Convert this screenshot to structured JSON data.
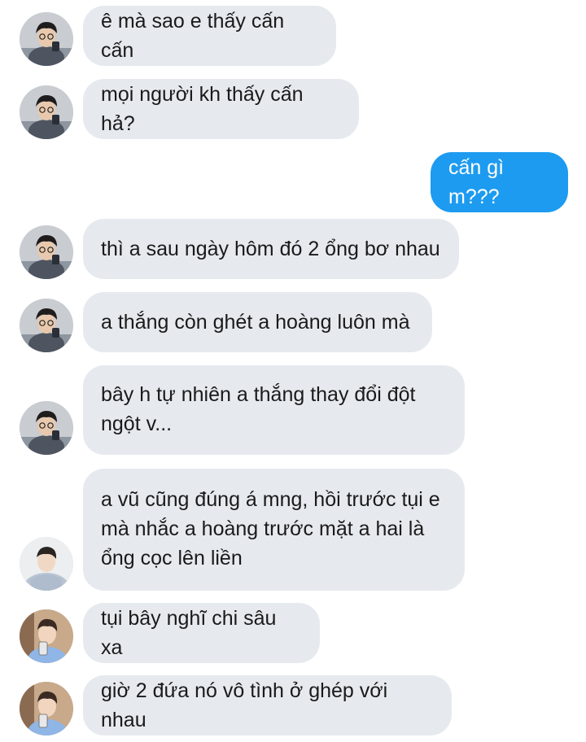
{
  "colors": {
    "incoming_bubble": "#e6eaef",
    "outgoing_bubble": "#1d9bf0",
    "incoming_text": "#1a1a1a",
    "outgoing_text": "#ffffff",
    "background": "#ffffff"
  },
  "messages": [
    {
      "sender": "user-a",
      "text": "ê mà sao e thấy cấn cấn"
    },
    {
      "sender": "user-a",
      "text": "mọi người kh thấy cấn hả?"
    },
    {
      "sender": "me",
      "text": "cấn gì m???"
    },
    {
      "sender": "user-a",
      "text": "thì a sau ngày hôm đó 2 ổng bơ nhau"
    },
    {
      "sender": "user-a",
      "text": "a thắng còn ghét a hoàng luôn mà"
    },
    {
      "sender": "user-a",
      "text": "bây h tự nhiên a thắng thay đổi đột\nngột v..."
    },
    {
      "sender": "user-b",
      "text": "a vũ cũng đúng á mng, hồi trước tụi e\nmà nhắc a hoàng trước mặt a hai là\nổng cọc lên liền"
    },
    {
      "sender": "user-c",
      "text": "tụi bây nghĩ chi sâu xa"
    },
    {
      "sender": "user-c",
      "text": "giờ 2 đứa nó vô tình ở ghép với nhau"
    }
  ],
  "avatars": {
    "user-a": "avatar-glasses-man-icon",
    "user-b": "avatar-hoodie-man-icon",
    "user-c": "avatar-mirror-selfie-icon"
  }
}
